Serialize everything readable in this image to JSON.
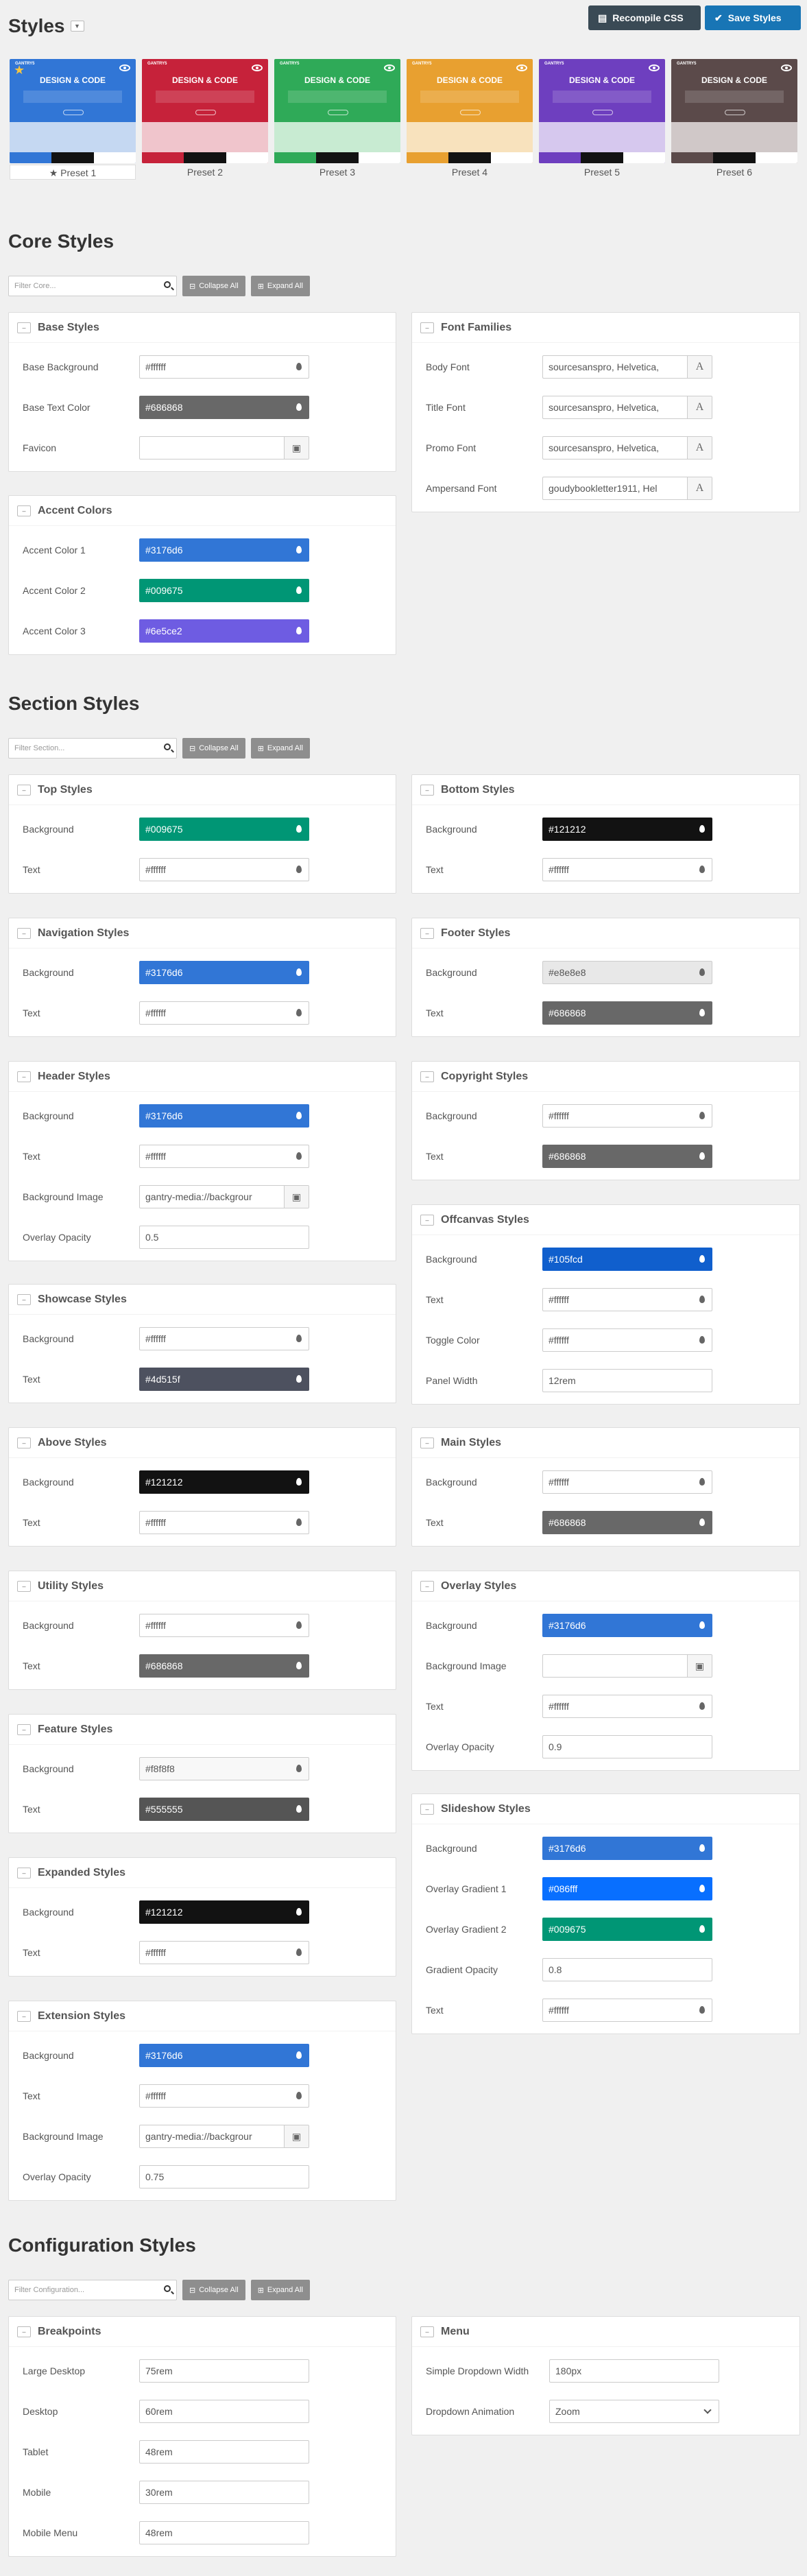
{
  "header": {
    "title": "Styles",
    "recompile": "Recompile CSS",
    "save": "Save Styles"
  },
  "presets": [
    {
      "label": "Preset 1",
      "active": true,
      "bg": "#3176d6",
      "top": "#3176d6",
      "lower": "#c5d8f2",
      "strip": [
        "#3176d6",
        "#121212",
        "#ffffff"
      ]
    },
    {
      "label": "Preset 2",
      "active": false,
      "bg": "#c6223a",
      "top": "#c6223a",
      "lower": "#f0c5cc",
      "strip": [
        "#c6223a",
        "#121212",
        "#ffffff"
      ]
    },
    {
      "label": "Preset 3",
      "active": false,
      "bg": "#2faa58",
      "top": "#2faa58",
      "lower": "#c8ebd2",
      "strip": [
        "#2faa58",
        "#121212",
        "#ffffff"
      ]
    },
    {
      "label": "Preset 4",
      "active": false,
      "bg": "#e8a030",
      "top": "#e8a030",
      "lower": "#f8e2bd",
      "strip": [
        "#e8a030",
        "#121212",
        "#ffffff"
      ]
    },
    {
      "label": "Preset 5",
      "active": false,
      "bg": "#6e3fbf",
      "top": "#6e3fbf",
      "lower": "#d6c8ee",
      "strip": [
        "#6e3fbf",
        "#121212",
        "#ffffff"
      ]
    },
    {
      "label": "Preset 6",
      "active": false,
      "bg": "#5b4a4a",
      "top": "#5b4a4a",
      "lower": "#d0c8c8",
      "strip": [
        "#5b4a4a",
        "#121212",
        "#ffffff"
      ]
    }
  ],
  "preset_thumb": {
    "brand": "GANTRY5",
    "title": "DESIGN & CODE"
  },
  "core": {
    "title": "Core Styles",
    "filter": "Filter Core...",
    "collapse": "Collapse All",
    "expand": "Expand All"
  },
  "section": {
    "title": "Section Styles",
    "filter": "Filter Section...",
    "collapse": "Collapse All",
    "expand": "Expand All"
  },
  "config": {
    "title": "Configuration Styles",
    "filter": "Filter Configuration...",
    "collapse": "Collapse All",
    "expand": "Expand All"
  },
  "cards": [
    {
      "title": "Base Styles",
      "rows": [
        {
          "label": "Base Background",
          "value": "#ffffff",
          "type": "color",
          "bg": "#ffffff"
        },
        {
          "label": "Base Text Color",
          "value": "#686868",
          "type": "color",
          "bg": "#686868"
        },
        {
          "label": "Favicon",
          "value": "",
          "type": "file"
        }
      ]
    },
    {
      "title": "Accent Colors",
      "rows": [
        {
          "label": "Accent Color 1",
          "value": "#3176d6",
          "type": "color",
          "bg": "#3176d6"
        },
        {
          "label": "Accent Color 2",
          "value": "#009675",
          "type": "color",
          "bg": "#009675"
        },
        {
          "label": "Accent Color 3",
          "value": "#6e5ce2",
          "type": "color",
          "bg": "#6e5ce2"
        }
      ]
    },
    {
      "title": "Font Families",
      "rows": [
        {
          "label": "Body Font",
          "value": "sourcesanspro, Helvetica,",
          "type": "font"
        },
        {
          "label": "Title Font",
          "value": "sourcesanspro, Helvetica,",
          "type": "font"
        },
        {
          "label": "Promo Font",
          "value": "sourcesanspro, Helvetica,",
          "type": "font"
        },
        {
          "label": "Ampersand Font",
          "value": "goudybookletter1911, Hel",
          "type": "font"
        }
      ]
    },
    {
      "title": "Top Styles",
      "rows": [
        {
          "label": "Background",
          "value": "#009675",
          "type": "color",
          "bg": "#009675"
        },
        {
          "label": "Text",
          "value": "#ffffff",
          "type": "color",
          "bg": "#ffffff"
        }
      ]
    },
    {
      "title": "Navigation Styles",
      "rows": [
        {
          "label": "Background",
          "value": "#3176d6",
          "type": "color",
          "bg": "#3176d6"
        },
        {
          "label": "Text",
          "value": "#ffffff",
          "type": "color",
          "bg": "#ffffff"
        }
      ]
    },
    {
      "title": "Header Styles",
      "rows": [
        {
          "label": "Background",
          "value": "#3176d6",
          "type": "color",
          "bg": "#3176d6"
        },
        {
          "label": "Text",
          "value": "#ffffff",
          "type": "color",
          "bg": "#ffffff"
        },
        {
          "label": "Background Image",
          "value": "gantry-media://backgrour",
          "type": "file"
        },
        {
          "label": "Overlay Opacity",
          "value": "0.5",
          "type": "text"
        }
      ]
    },
    {
      "title": "Showcase Styles",
      "rows": [
        {
          "label": "Background",
          "value": "#ffffff",
          "type": "color",
          "bg": "#ffffff"
        },
        {
          "label": "Text",
          "value": "#4d515f",
          "type": "color",
          "bg": "#4d515f"
        }
      ]
    },
    {
      "title": "Above Styles",
      "rows": [
        {
          "label": "Background",
          "value": "#121212",
          "type": "color",
          "bg": "#121212"
        },
        {
          "label": "Text",
          "value": "#ffffff",
          "type": "color",
          "bg": "#ffffff"
        }
      ]
    },
    {
      "title": "Utility Styles",
      "rows": [
        {
          "label": "Background",
          "value": "#ffffff",
          "type": "color",
          "bg": "#ffffff"
        },
        {
          "label": "Text",
          "value": "#686868",
          "type": "color",
          "bg": "#686868"
        }
      ]
    },
    {
      "title": "Feature Styles",
      "rows": [
        {
          "label": "Background",
          "value": "#f8f8f8",
          "type": "color",
          "bg": "#f8f8f8"
        },
        {
          "label": "Text",
          "value": "#555555",
          "type": "color",
          "bg": "#555555"
        }
      ]
    },
    {
      "title": "Expanded Styles",
      "rows": [
        {
          "label": "Background",
          "value": "#121212",
          "type": "color",
          "bg": "#121212"
        },
        {
          "label": "Text",
          "value": "#ffffff",
          "type": "color",
          "bg": "#ffffff"
        }
      ]
    },
    {
      "title": "Extension Styles",
      "rows": [
        {
          "label": "Background",
          "value": "#3176d6",
          "type": "color",
          "bg": "#3176d6"
        },
        {
          "label": "Text",
          "value": "#ffffff",
          "type": "color",
          "bg": "#ffffff"
        },
        {
          "label": "Background Image",
          "value": "gantry-media://backgrour",
          "type": "file"
        },
        {
          "label": "Overlay Opacity",
          "value": "0.75",
          "type": "text"
        }
      ]
    },
    {
      "title": "Bottom Styles",
      "rows": [
        {
          "label": "Background",
          "value": "#121212",
          "type": "color",
          "bg": "#121212"
        },
        {
          "label": "Text",
          "value": "#ffffff",
          "type": "color",
          "bg": "#ffffff"
        }
      ]
    },
    {
      "title": "Footer Styles",
      "rows": [
        {
          "label": "Background",
          "value": "#e8e8e8",
          "type": "color",
          "bg": "#e8e8e8"
        },
        {
          "label": "Text",
          "value": "#686868",
          "type": "color",
          "bg": "#686868"
        }
      ]
    },
    {
      "title": "Copyright Styles",
      "rows": [
        {
          "label": "Background",
          "value": "#ffffff",
          "type": "color",
          "bg": "#ffffff"
        },
        {
          "label": "Text",
          "value": "#686868",
          "type": "color",
          "bg": "#686868"
        }
      ]
    },
    {
      "title": "Offcanvas Styles",
      "rows": [
        {
          "label": "Background",
          "value": "#105fcd",
          "type": "color",
          "bg": "#105fcd"
        },
        {
          "label": "Text",
          "value": "#ffffff",
          "type": "color",
          "bg": "#ffffff"
        },
        {
          "label": "Toggle Color",
          "value": "#ffffff",
          "type": "color",
          "bg": "#ffffff"
        },
        {
          "label": "Panel Width",
          "value": "12rem",
          "type": "text"
        }
      ]
    },
    {
      "title": "Main Styles",
      "rows": [
        {
          "label": "Background",
          "value": "#ffffff",
          "type": "color",
          "bg": "#ffffff"
        },
        {
          "label": "Text",
          "value": "#686868",
          "type": "color",
          "bg": "#686868"
        }
      ]
    },
    {
      "title": "Overlay Styles",
      "rows": [
        {
          "label": "Background",
          "value": "#3176d6",
          "type": "color",
          "bg": "#3176d6"
        },
        {
          "label": "Background Image",
          "value": "",
          "type": "file"
        },
        {
          "label": "Text",
          "value": "#ffffff",
          "type": "color",
          "bg": "#ffffff"
        },
        {
          "label": "Overlay Opacity",
          "value": "0.9",
          "type": "text"
        }
      ]
    },
    {
      "title": "Slideshow Styles",
      "rows": [
        {
          "label": "Background",
          "value": "#3176d6",
          "type": "color",
          "bg": "#3176d6"
        },
        {
          "label": "Overlay Gradient 1",
          "value": "#086fff",
          "type": "color",
          "bg": "#086fff"
        },
        {
          "label": "Overlay Gradient 2",
          "value": "#009675",
          "type": "color",
          "bg": "#009675"
        },
        {
          "label": "Gradient Opacity",
          "value": "0.8",
          "type": "text"
        },
        {
          "label": "Text",
          "value": "#ffffff",
          "type": "color",
          "bg": "#ffffff"
        }
      ]
    },
    {
      "title": "Breakpoints",
      "rows": [
        {
          "label": "Large Desktop",
          "value": "75rem",
          "type": "text"
        },
        {
          "label": "Desktop",
          "value": "60rem",
          "type": "text"
        },
        {
          "label": "Tablet",
          "value": "48rem",
          "type": "text"
        },
        {
          "label": "Mobile",
          "value": "30rem",
          "type": "text"
        },
        {
          "label": "Mobile Menu",
          "value": "48rem",
          "type": "text"
        }
      ]
    },
    {
      "title": "Menu",
      "rows": [
        {
          "label": "Simple Dropdown Width",
          "value": "180px",
          "type": "text"
        },
        {
          "label": "Dropdown Animation",
          "value": "Zoom",
          "type": "select"
        }
      ]
    }
  ]
}
